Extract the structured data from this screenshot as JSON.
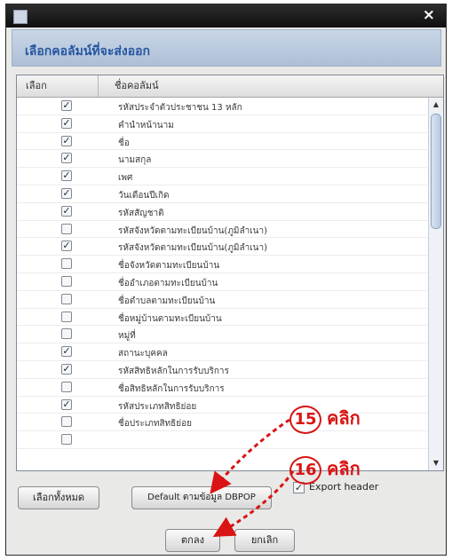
{
  "dialog": {
    "title": "",
    "close_symbol": "×",
    "header_title": "เลือกคอลัมน์ที่จะส่งออก"
  },
  "table": {
    "col_select": "เลือก",
    "col_name": "ชื่อคอลัมน์",
    "rows": [
      {
        "checked": "✓",
        "label": "รหัสประจำตัวประชาชน 13 หลัก"
      },
      {
        "checked": "✓",
        "label": "คำนำหน้านาม"
      },
      {
        "checked": "✓",
        "label": "ชื่อ"
      },
      {
        "checked": "✓",
        "label": "นามสกุล"
      },
      {
        "checked": "✓",
        "label": "เพศ"
      },
      {
        "checked": "✓",
        "label": "วันเดือนปีเกิด"
      },
      {
        "checked": "✓",
        "label": "รหัสสัญชาติ"
      },
      {
        "checked": "",
        "label": "รหัสจังหวัดตามทะเบียนบ้าน(ภูมิลำเนา)"
      },
      {
        "checked": "✓",
        "label": "รหัสจังหวัดตามทะเบียนบ้าน(ภูมิลำเนา)"
      },
      {
        "checked": "",
        "label": "ชื่อจังหวัดตามทะเบียนบ้าน"
      },
      {
        "checked": "",
        "label": "ชื่ออำเภอตามทะเบียนบ้าน"
      },
      {
        "checked": "",
        "label": "ชื่อตำบลตามทะเบียนบ้าน"
      },
      {
        "checked": "",
        "label": "ชื่อหมู่บ้านตามทะเบียนบ้าน"
      },
      {
        "checked": "",
        "label": "หมู่ที่"
      },
      {
        "checked": "✓",
        "label": "สถานะบุคคล"
      },
      {
        "checked": "✓",
        "label": "รหัสสิทธิหลักในการรับบริการ"
      },
      {
        "checked": "",
        "label": "ชื่อสิทธิหลักในการรับบริการ"
      },
      {
        "checked": "✓",
        "label": "รหัสประเภทสิทธิย่อย"
      },
      {
        "checked": "",
        "label": "ชื่อประเภทสิทธิย่อย"
      },
      {
        "checked": "",
        "label": ""
      }
    ]
  },
  "buttons": {
    "select_all": "เลือกทั้งหมด",
    "default": "Default ตามข้อมูล DBPOP",
    "export_header": "Export header",
    "export_checked": "✓",
    "ok": "ตกลง",
    "cancel": "ยกเลิก"
  },
  "annotations": {
    "step15_num": "15",
    "step15_text": "คลิก",
    "step16_num": "16",
    "step16_text": "คลิก",
    "color": "#d91414"
  },
  "colors": {
    "titlebar": "#1a1a1a",
    "header_band": "#b8c8dc",
    "header_text": "#24569f"
  },
  "icons": {
    "app": "app-window-icon",
    "close": "close-icon",
    "scroll_up": "triangle-up-icon",
    "scroll_down": "triangle-down-icon"
  }
}
